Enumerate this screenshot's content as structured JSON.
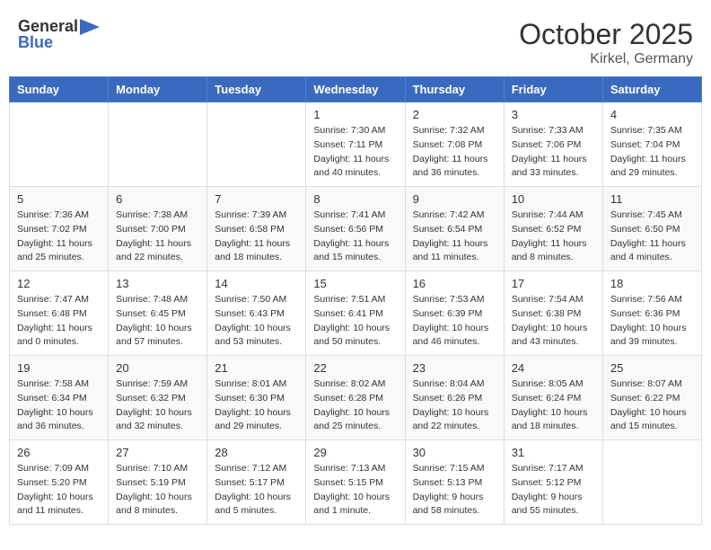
{
  "logo": {
    "general": "General",
    "blue": "Blue"
  },
  "header": {
    "month": "October 2025",
    "location": "Kirkel, Germany"
  },
  "weekdays": [
    "Sunday",
    "Monday",
    "Tuesday",
    "Wednesday",
    "Thursday",
    "Friday",
    "Saturday"
  ],
  "weeks": [
    [
      {
        "day": "",
        "info": ""
      },
      {
        "day": "",
        "info": ""
      },
      {
        "day": "",
        "info": ""
      },
      {
        "day": "1",
        "info": "Sunrise: 7:30 AM\nSunset: 7:11 PM\nDaylight: 11 hours\nand 40 minutes."
      },
      {
        "day": "2",
        "info": "Sunrise: 7:32 AM\nSunset: 7:08 PM\nDaylight: 11 hours\nand 36 minutes."
      },
      {
        "day": "3",
        "info": "Sunrise: 7:33 AM\nSunset: 7:06 PM\nDaylight: 11 hours\nand 33 minutes."
      },
      {
        "day": "4",
        "info": "Sunrise: 7:35 AM\nSunset: 7:04 PM\nDaylight: 11 hours\nand 29 minutes."
      }
    ],
    [
      {
        "day": "5",
        "info": "Sunrise: 7:36 AM\nSunset: 7:02 PM\nDaylight: 11 hours\nand 25 minutes."
      },
      {
        "day": "6",
        "info": "Sunrise: 7:38 AM\nSunset: 7:00 PM\nDaylight: 11 hours\nand 22 minutes."
      },
      {
        "day": "7",
        "info": "Sunrise: 7:39 AM\nSunset: 6:58 PM\nDaylight: 11 hours\nand 18 minutes."
      },
      {
        "day": "8",
        "info": "Sunrise: 7:41 AM\nSunset: 6:56 PM\nDaylight: 11 hours\nand 15 minutes."
      },
      {
        "day": "9",
        "info": "Sunrise: 7:42 AM\nSunset: 6:54 PM\nDaylight: 11 hours\nand 11 minutes."
      },
      {
        "day": "10",
        "info": "Sunrise: 7:44 AM\nSunset: 6:52 PM\nDaylight: 11 hours\nand 8 minutes."
      },
      {
        "day": "11",
        "info": "Sunrise: 7:45 AM\nSunset: 6:50 PM\nDaylight: 11 hours\nand 4 minutes."
      }
    ],
    [
      {
        "day": "12",
        "info": "Sunrise: 7:47 AM\nSunset: 6:48 PM\nDaylight: 11 hours\nand 0 minutes."
      },
      {
        "day": "13",
        "info": "Sunrise: 7:48 AM\nSunset: 6:45 PM\nDaylight: 10 hours\nand 57 minutes."
      },
      {
        "day": "14",
        "info": "Sunrise: 7:50 AM\nSunset: 6:43 PM\nDaylight: 10 hours\nand 53 minutes."
      },
      {
        "day": "15",
        "info": "Sunrise: 7:51 AM\nSunset: 6:41 PM\nDaylight: 10 hours\nand 50 minutes."
      },
      {
        "day": "16",
        "info": "Sunrise: 7:53 AM\nSunset: 6:39 PM\nDaylight: 10 hours\nand 46 minutes."
      },
      {
        "day": "17",
        "info": "Sunrise: 7:54 AM\nSunset: 6:38 PM\nDaylight: 10 hours\nand 43 minutes."
      },
      {
        "day": "18",
        "info": "Sunrise: 7:56 AM\nSunset: 6:36 PM\nDaylight: 10 hours\nand 39 minutes."
      }
    ],
    [
      {
        "day": "19",
        "info": "Sunrise: 7:58 AM\nSunset: 6:34 PM\nDaylight: 10 hours\nand 36 minutes."
      },
      {
        "day": "20",
        "info": "Sunrise: 7:59 AM\nSunset: 6:32 PM\nDaylight: 10 hours\nand 32 minutes."
      },
      {
        "day": "21",
        "info": "Sunrise: 8:01 AM\nSunset: 6:30 PM\nDaylight: 10 hours\nand 29 minutes."
      },
      {
        "day": "22",
        "info": "Sunrise: 8:02 AM\nSunset: 6:28 PM\nDaylight: 10 hours\nand 25 minutes."
      },
      {
        "day": "23",
        "info": "Sunrise: 8:04 AM\nSunset: 6:26 PM\nDaylight: 10 hours\nand 22 minutes."
      },
      {
        "day": "24",
        "info": "Sunrise: 8:05 AM\nSunset: 6:24 PM\nDaylight: 10 hours\nand 18 minutes."
      },
      {
        "day": "25",
        "info": "Sunrise: 8:07 AM\nSunset: 6:22 PM\nDaylight: 10 hours\nand 15 minutes."
      }
    ],
    [
      {
        "day": "26",
        "info": "Sunrise: 7:09 AM\nSunset: 5:20 PM\nDaylight: 10 hours\nand 11 minutes."
      },
      {
        "day": "27",
        "info": "Sunrise: 7:10 AM\nSunset: 5:19 PM\nDaylight: 10 hours\nand 8 minutes."
      },
      {
        "day": "28",
        "info": "Sunrise: 7:12 AM\nSunset: 5:17 PM\nDaylight: 10 hours\nand 5 minutes."
      },
      {
        "day": "29",
        "info": "Sunrise: 7:13 AM\nSunset: 5:15 PM\nDaylight: 10 hours\nand 1 minute."
      },
      {
        "day": "30",
        "info": "Sunrise: 7:15 AM\nSunset: 5:13 PM\nDaylight: 9 hours\nand 58 minutes."
      },
      {
        "day": "31",
        "info": "Sunrise: 7:17 AM\nSunset: 5:12 PM\nDaylight: 9 hours\nand 55 minutes."
      },
      {
        "day": "",
        "info": ""
      }
    ]
  ]
}
